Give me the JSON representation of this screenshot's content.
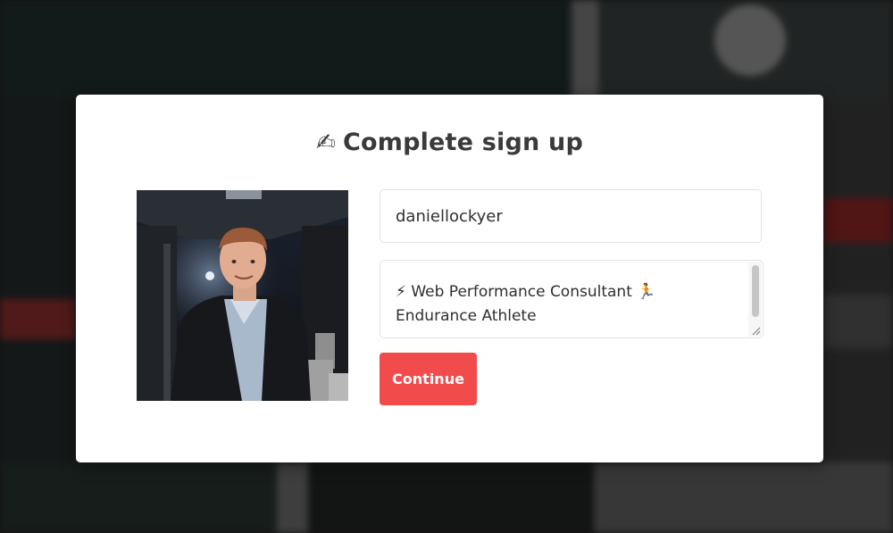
{
  "modal": {
    "title_icon": "✍",
    "title": "Complete sign up",
    "avatar_alt": "profile photo",
    "username": {
      "value": "daniellockyer",
      "placeholder": ""
    },
    "bio": {
      "value": "⚡ Web Performance Consultant 🏃\nEndurance Athlete",
      "placeholder": ""
    },
    "continue_label": "Continue"
  },
  "colors": {
    "accent": "#f24b4b",
    "title_text": "#3a3a3a",
    "input_border": "#e3e3e3",
    "overlay": "#1f1f1f"
  },
  "icons": {
    "title_icon": "writing-hand-icon",
    "resize": "resize-handle-icon"
  }
}
